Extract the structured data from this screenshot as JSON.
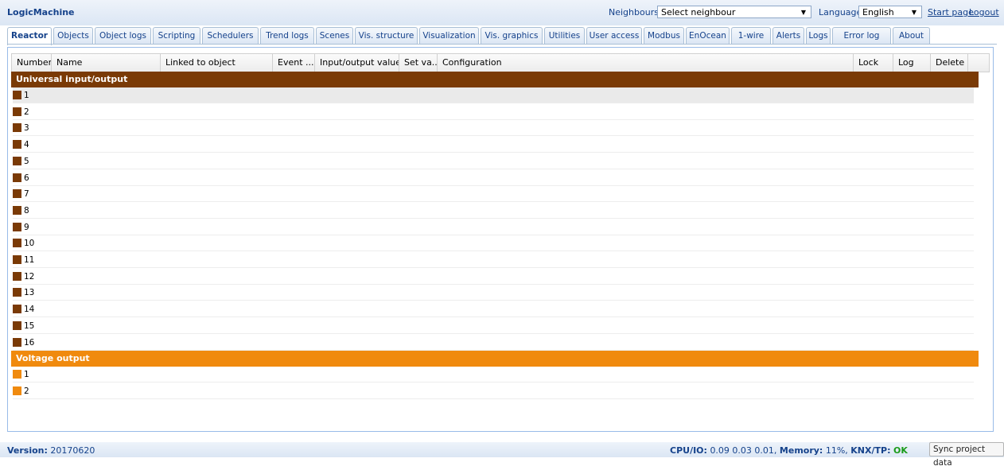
{
  "header": {
    "app_title": "LogicMachine",
    "neighbours_label": "Neighbours:",
    "neighbours_value": "Select neighbour",
    "language_label": "Language:",
    "language_value": "English",
    "start_page": "Start page",
    "logout": "Logout"
  },
  "tabs": [
    "Reactor",
    "Objects",
    "Object logs",
    "Scripting",
    "Schedulers",
    "Trend logs",
    "Scenes",
    "Vis. structure",
    "Visualization",
    "Vis. graphics",
    "Utilities",
    "User access",
    "Modbus",
    "EnOcean",
    "1-wire",
    "Alerts",
    "Logs",
    "Error log",
    "About"
  ],
  "active_tab": "Reactor",
  "grid": {
    "columns": [
      "Number",
      "Name",
      "Linked to object",
      "Event ...",
      "Input/output value",
      "Set va...",
      "Configuration",
      "Lock",
      "Log",
      "Delete"
    ],
    "groups": [
      {
        "title": "Universal input/output",
        "color": "#7a3a06",
        "rows": [
          "1",
          "2",
          "3",
          "4",
          "5",
          "6",
          "7",
          "8",
          "9",
          "10",
          "11",
          "12",
          "13",
          "14",
          "15",
          "16"
        ]
      },
      {
        "title": "Voltage output",
        "color": "#f08a0e",
        "rows": [
          "1",
          "2"
        ]
      }
    ]
  },
  "footer": {
    "version_label": "Version:",
    "version_value": "20170620",
    "cpu_label": "CPU/IO:",
    "cpu_value": "0.09 0.03 0.01,",
    "memory_label": "Memory:",
    "memory_value": "11%,",
    "knx_label": "KNX/TP:",
    "knx_value": "OK",
    "sync_button": "Sync project data"
  }
}
